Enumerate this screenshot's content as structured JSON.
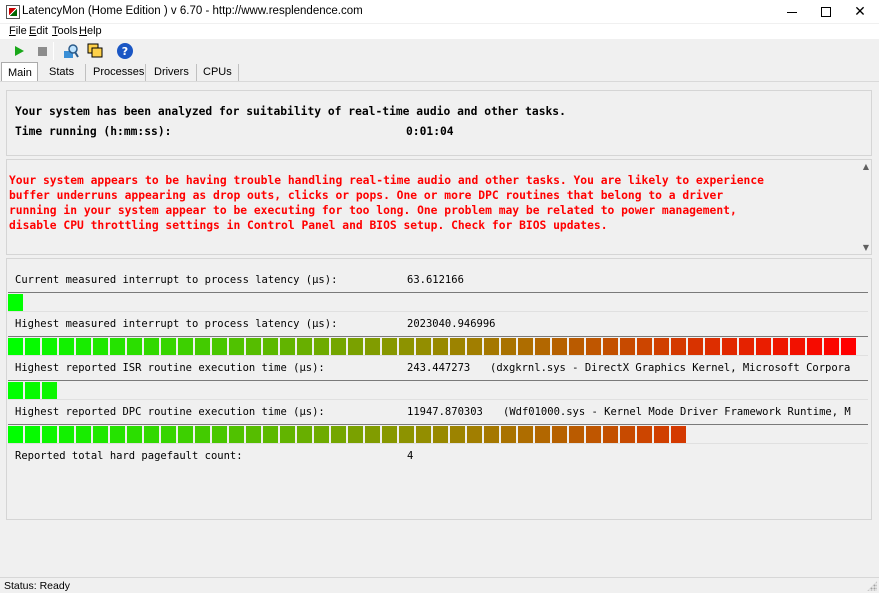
{
  "window": {
    "title": "LatencyMon  (Home Edition )  v 6.70 - http://www.resplendence.com",
    "minimize_glyph": "min",
    "maximize_glyph": "max",
    "close_glyph": "✕"
  },
  "menu": {
    "items": [
      {
        "underline": "F",
        "rest": "ile"
      },
      {
        "underline": "E",
        "rest": "dit"
      },
      {
        "underline": "T",
        "rest": "ools"
      },
      {
        "underline": "H",
        "rest": "elp"
      }
    ]
  },
  "toolbar": {
    "icons": [
      "play-icon",
      "stop-icon",
      "search-icon",
      "windows-icon",
      "help-icon"
    ],
    "colors": {
      "play": "#1aa81a",
      "stop": "#8c8c8c",
      "help": "#1a56c4"
    }
  },
  "tabs": [
    "Main",
    "Stats",
    "Processes",
    "Drivers",
    "CPUs"
  ],
  "summary": {
    "line1": "Your system has been analyzed for suitability of real-time audio and other tasks.",
    "time_label": "Time running (h:mm:ss):",
    "time_value": "0:01:04"
  },
  "warning": {
    "lines": [
      "Your system appears to be having trouble handling real-time audio and other tasks. You are likely to experience",
      "buffer underruns appearing as drop outs, clicks or pops. One or more DPC routines that belong to a driver",
      "running in your system appear to be executing for too long. One problem may be related to power management,",
      "disable CPU throttling settings in Control Panel and BIOS setup. Check for BIOS updates."
    ],
    "color": "#ff0000"
  },
  "metrics": [
    {
      "label": "Current measured interrupt to process latency (µs):",
      "value": "63.612166",
      "detail": "",
      "fill_fraction": 0.02
    },
    {
      "label": "Highest measured interrupt to process latency (µs):",
      "value": "2023040.946996",
      "detail": "",
      "fill_fraction": 1.0
    },
    {
      "label": "Highest reported ISR routine execution time (µs):",
      "value": "243.447273",
      "detail": "(dxgkrnl.sys - DirectX Graphics Kernel, Microsoft Corpora",
      "fill_fraction": 0.06
    },
    {
      "label": "Highest reported DPC routine execution time (µs):",
      "value": "11947.870303",
      "detail": "(Wdf01000.sys - Kernel Mode Driver Framework Runtime, M",
      "fill_fraction": 0.8
    }
  ],
  "pagefault": {
    "label": "Reported total hard pagefault count:",
    "value": "4"
  },
  "bar_colors": {
    "start": "#00ff00",
    "end": "#ff0000"
  },
  "status": "Status: Ready"
}
